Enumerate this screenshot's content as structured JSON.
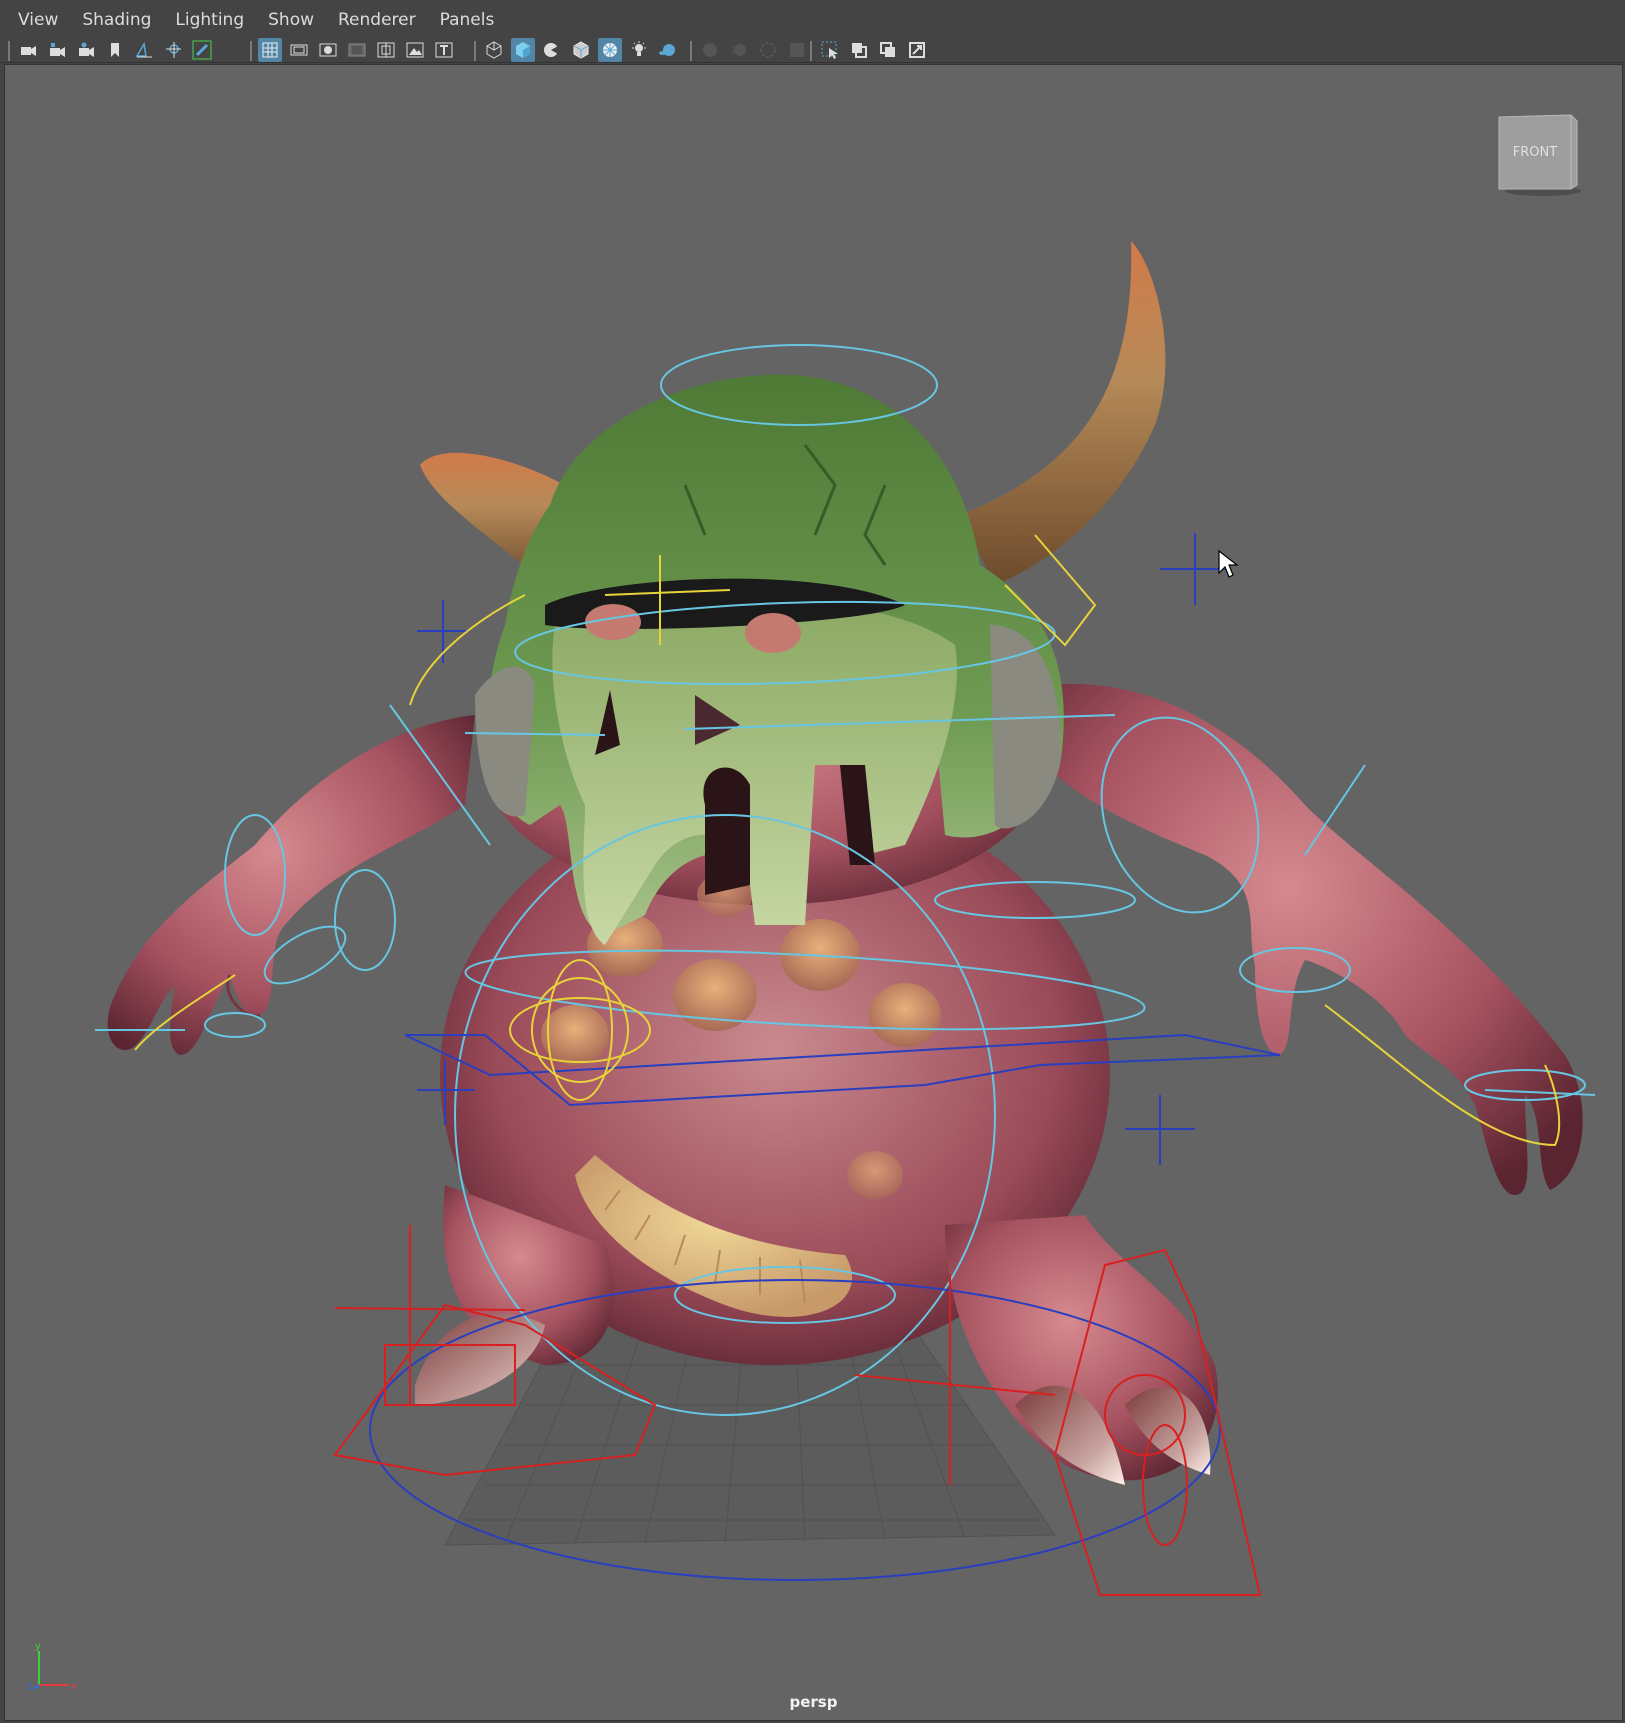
{
  "menu": {
    "view": "View",
    "shading": "Shading",
    "lighting": "Lighting",
    "show": "Show",
    "renderer": "Renderer",
    "panels": "Panels"
  },
  "toolbar": {
    "groups": [
      [
        "select-camera-icon",
        "camera-attributes-icon",
        "camera-lock-icon",
        "bookmark-icon",
        "image-plane-icon",
        "2d-pan-zoom-icon",
        "grease-pencil-icon"
      ],
      [
        "grid-icon",
        "film-gate-icon",
        "resolution-gate-icon",
        "gate-mask-icon",
        "field-chart-icon",
        "safe-action-icon",
        "safe-title-icon"
      ],
      [
        "wireframe-icon",
        "smooth-shade-icon",
        "wireframe-on-shaded-icon",
        "textured-icon",
        "use-all-lights-icon",
        "shadows-icon",
        "xray-icon"
      ],
      [
        "screen-space-ao-icon",
        "motion-blur-icon",
        "multisample-aa-icon",
        "depth-of-field-icon"
      ],
      [
        "isolate-select-icon",
        "xray-joints-icon",
        "xray-active-icon",
        "hud-icon"
      ]
    ],
    "active": [
      "grid-icon",
      "smooth-shade-icon",
      "use-all-lights-icon"
    ]
  },
  "viewport": {
    "camera": "persp",
    "viewcube_face": "FRONT",
    "axis": {
      "x": "x",
      "y": "y",
      "z": "z"
    },
    "colors": {
      "background": "#646464",
      "skin": "#b8656d",
      "helmet": "#5e8a45",
      "horn": "#a8784a",
      "control_cyan": "#67c6e2",
      "control_blue": "#2a3fbf",
      "control_yellow": "#e8d23a",
      "control_red": "#d82020"
    }
  }
}
